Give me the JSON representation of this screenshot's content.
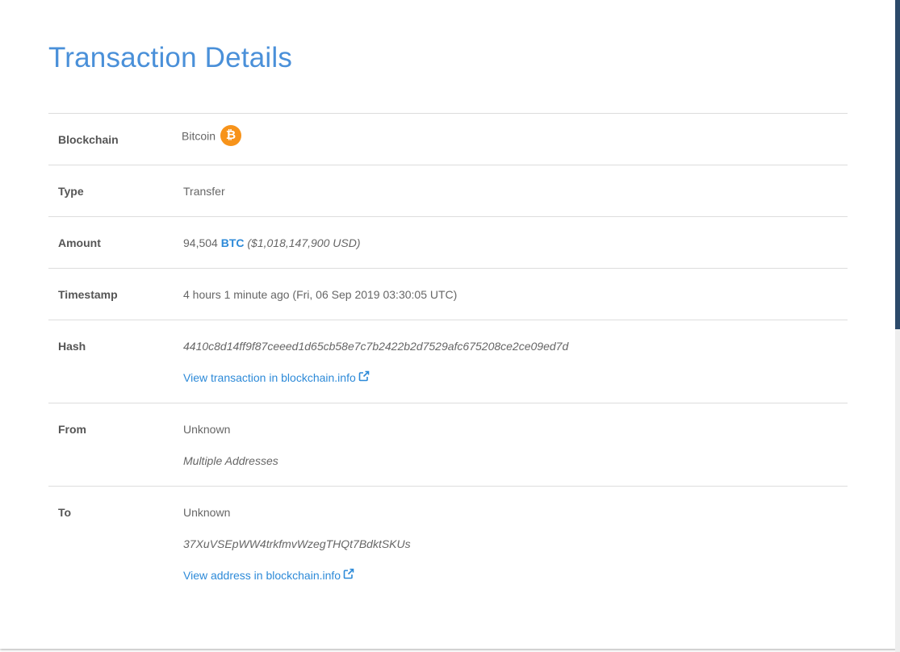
{
  "page": {
    "title": "Transaction Details"
  },
  "rows": {
    "blockchain": {
      "label": "Blockchain",
      "value": "Bitcoin",
      "icon": "bitcoin-icon",
      "icon_glyph": "₿"
    },
    "type": {
      "label": "Type",
      "value": "Transfer"
    },
    "amount": {
      "label": "Amount",
      "quantity": "94,504",
      "unit": "BTC",
      "usd": "($1,018,147,900 USD)"
    },
    "timestamp": {
      "label": "Timestamp",
      "value": "4 hours 1 minute ago (Fri, 06 Sep 2019 03:30:05 UTC)"
    },
    "hash": {
      "label": "Hash",
      "value": "4410c8d14ff9f87ceeed1d65cb58e7c7b2422b2d7529afc675208ce2ce09ed7d",
      "link_text": "View transaction in blockchain.info"
    },
    "from": {
      "label": "From",
      "owner": "Unknown",
      "address": "Multiple Addresses"
    },
    "to": {
      "label": "To",
      "owner": "Unknown",
      "address": "37XuVSEpWW4trkfmvWzegTHQt7BdktSKUs",
      "link_text": "View address in blockchain.info"
    }
  },
  "colors": {
    "accent": "#4a90d9",
    "link": "#2d8ad8",
    "bitcoin": "#f7931a"
  }
}
